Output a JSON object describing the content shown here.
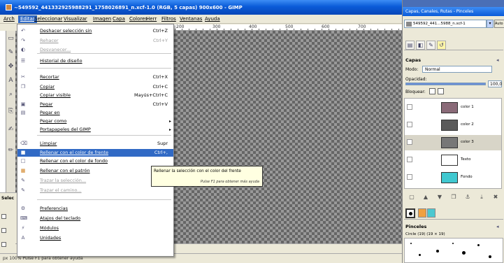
{
  "window": {
    "title": "~549592_441332925988291_1758026891_n.xcf-1.0 (RGB, 5 capas) 900x600 - GIMP"
  },
  "menubar": {
    "items": [
      "Arch",
      "Editar",
      "Seleccionar",
      "Visualizar",
      "Imagen",
      "Capa",
      "Colores",
      "Herr",
      "Filtros",
      "Ventanas",
      "Ayuda"
    ]
  },
  "ruler": {
    "ticks": [
      "200",
      "300",
      "400",
      "500",
      "600",
      "700"
    ]
  },
  "edit_menu": {
    "items": [
      {
        "label": "Deshacer selección sin",
        "shortcut": "Ctrl+Z",
        "icon": "undo-icon",
        "disabled": false
      },
      {
        "label": "Rehacer",
        "shortcut": "Ctrl+Y",
        "icon": "redo-icon",
        "disabled": true
      },
      {
        "label": "Desvanecer...",
        "shortcut": "",
        "icon": "fade-icon",
        "disabled": true
      },
      {
        "label": "Historial de diseño",
        "shortcut": "",
        "icon": "history-icon",
        "disabled": false
      },
      {
        "label": "Recortar",
        "shortcut": "Ctrl+X",
        "icon": "cut-icon",
        "disabled": false
      },
      {
        "label": "Copiar",
        "shortcut": "Ctrl+C",
        "icon": "copy-icon",
        "disabled": false
      },
      {
        "label": "Copiar visible",
        "shortcut": "Mayús+Ctrl+C",
        "icon": "",
        "disabled": false
      },
      {
        "label": "Pegar",
        "shortcut": "Ctrl+V",
        "icon": "paste-icon",
        "disabled": false
      },
      {
        "label": "Pegar en",
        "shortcut": "",
        "icon": "paste-into-icon",
        "disabled": false
      },
      {
        "label": "Pegar como",
        "shortcut": "",
        "icon": "",
        "disabled": false,
        "submenu": true
      },
      {
        "label": "Portapapeles del GIMP",
        "shortcut": "",
        "icon": "",
        "disabled": false,
        "submenu": true
      },
      {
        "label": "Limpiar",
        "shortcut": "Supr",
        "icon": "clear-icon",
        "disabled": false
      },
      {
        "label": "Rellenar con el color de frente",
        "shortcut": "Ctrl+,",
        "icon": "fg-fill-icon",
        "disabled": false
      },
      {
        "label": "Rellenar con el color de fondo",
        "shortcut": "",
        "icon": "bg-fill-icon",
        "disabled": false
      },
      {
        "label": "Rellenar con el patrón",
        "shortcut": "",
        "icon": "pattern-fill-icon",
        "disabled": false
      },
      {
        "label": "Trazar la selección...",
        "shortcut": "",
        "icon": "stroke-selection-icon",
        "disabled": true
      },
      {
        "label": "Trazar el camino...",
        "shortcut": "",
        "icon": "stroke-path-icon",
        "disabled": true
      },
      {
        "label": "Preferencias",
        "shortcut": "",
        "icon": "preferences-icon",
        "disabled": false
      },
      {
        "label": "Atajos del teclado",
        "shortcut": "",
        "icon": "keyboard-icon",
        "disabled": false
      },
      {
        "label": "Módulos",
        "shortcut": "",
        "icon": "modules-icon",
        "disabled": false
      },
      {
        "label": "Unidades",
        "shortcut": "",
        "icon": "units-icon",
        "disabled": false
      }
    ]
  },
  "tooltip": {
    "text": "Rellenar la selección con el color del frente",
    "hint": "Pulse F1 para obtener más ayuda"
  },
  "dock": {
    "title": "Capas, Canales, Rutas - Pinceles",
    "image_select": "549592_441...5988_n.xcf-1",
    "auto_button": "Auto",
    "layers_title": "Capas",
    "mode_label": "Modo:",
    "mode_value": "Normal",
    "opacity_label": "Opacidad:",
    "opacity_value": "100,0",
    "opacity_fraction": 1.0,
    "lock_label": "Bloquear:",
    "layers": [
      {
        "name": "color 1",
        "thumb": "#8a6a78",
        "selected": false
      },
      {
        "name": "color 2",
        "thumb": "#5a5a5a",
        "selected": false
      },
      {
        "name": "color 3",
        "thumb": "#777777",
        "selected": true
      },
      {
        "name": "Texto",
        "thumb": "#ffffff",
        "selected": false
      },
      {
        "name": "Fondo",
        "thumb": "#40c8d0",
        "selected": false
      }
    ],
    "brush_title": "Pinceles",
    "brush_size": "Circle (19) (19 × 19)"
  },
  "toolbox": {
    "options_title": "Selec"
  },
  "status": {
    "text": "px  100%  Pulse F1 para obtener ayuda"
  }
}
